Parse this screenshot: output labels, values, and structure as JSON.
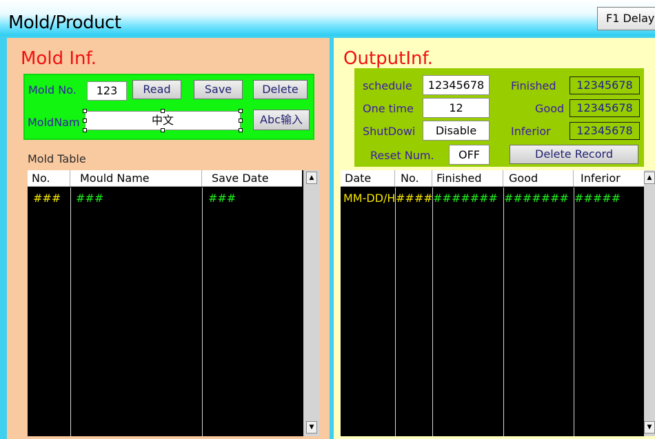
{
  "window": {
    "title": "Mold/Product",
    "f1_button": "F1 Delay"
  },
  "mold_info": {
    "title": "Mold Inf.",
    "mold_no_label": "Mold No.",
    "mold_no_value": "123",
    "read_button": "Read",
    "save_button": "Save",
    "delete_button": "Delete",
    "mold_name_label": "MoldNam",
    "mold_name_value": "中文",
    "abc_input_button": "Abc输入"
  },
  "mold_table": {
    "title": "Mold Table",
    "columns": [
      "No.",
      "Mould Name",
      "Save Date"
    ],
    "rows": [
      [
        "###",
        "###",
        "###"
      ]
    ]
  },
  "output_info": {
    "title": "OutputInf.",
    "schedule_label": "schedule",
    "schedule_value": "12345678",
    "one_time_label": "One time",
    "one_time_value": "12",
    "shutdown_label": "ShutDowi",
    "shutdown_value": "Disable",
    "reset_label": "Reset Num.",
    "reset_value": "OFF",
    "finished_label": "Finished",
    "finished_value": "12345678",
    "good_label": "Good",
    "good_value": "12345678",
    "inferior_label": "Inferior",
    "inferior_value": "12345678",
    "delete_record_button": "Delete Record"
  },
  "output_table": {
    "columns": [
      "Date",
      "No.",
      "Finished",
      "Good",
      "Inferior"
    ],
    "rows": [
      [
        "MM-DD/H",
        "####",
        "#######",
        "#######",
        "#####"
      ]
    ]
  },
  "colors": {
    "accent_title": "#f01010",
    "mold_panel": "#f9c9a0",
    "output_panel": "#ffffc0",
    "mold_box": "#11f511",
    "output_box": "#98cd00",
    "table_text_yellow": "#f5e600",
    "table_text_green": "#20f020"
  }
}
